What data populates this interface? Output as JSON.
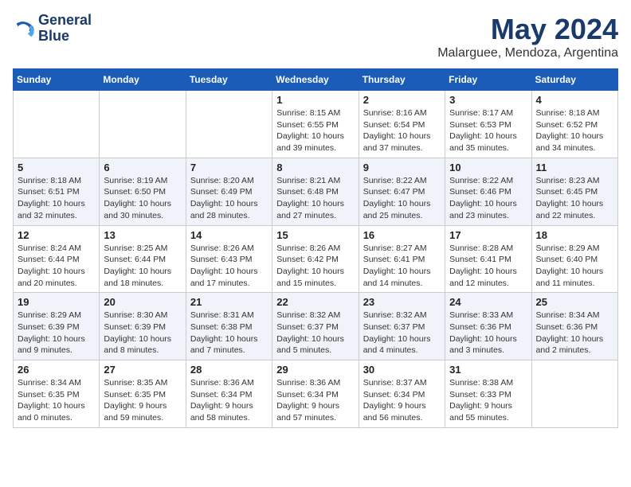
{
  "header": {
    "logo_line1": "General",
    "logo_line2": "Blue",
    "title": "May 2024",
    "subtitle": "Malarguee, Mendoza, Argentina"
  },
  "days_of_week": [
    "Sunday",
    "Monday",
    "Tuesday",
    "Wednesday",
    "Thursday",
    "Friday",
    "Saturday"
  ],
  "weeks": [
    [
      {
        "day": "",
        "info": ""
      },
      {
        "day": "",
        "info": ""
      },
      {
        "day": "",
        "info": ""
      },
      {
        "day": "1",
        "info": "Sunrise: 8:15 AM\nSunset: 6:55 PM\nDaylight: 10 hours\nand 39 minutes."
      },
      {
        "day": "2",
        "info": "Sunrise: 8:16 AM\nSunset: 6:54 PM\nDaylight: 10 hours\nand 37 minutes."
      },
      {
        "day": "3",
        "info": "Sunrise: 8:17 AM\nSunset: 6:53 PM\nDaylight: 10 hours\nand 35 minutes."
      },
      {
        "day": "4",
        "info": "Sunrise: 8:18 AM\nSunset: 6:52 PM\nDaylight: 10 hours\nand 34 minutes."
      }
    ],
    [
      {
        "day": "5",
        "info": "Sunrise: 8:18 AM\nSunset: 6:51 PM\nDaylight: 10 hours\nand 32 minutes."
      },
      {
        "day": "6",
        "info": "Sunrise: 8:19 AM\nSunset: 6:50 PM\nDaylight: 10 hours\nand 30 minutes."
      },
      {
        "day": "7",
        "info": "Sunrise: 8:20 AM\nSunset: 6:49 PM\nDaylight: 10 hours\nand 28 minutes."
      },
      {
        "day": "8",
        "info": "Sunrise: 8:21 AM\nSunset: 6:48 PM\nDaylight: 10 hours\nand 27 minutes."
      },
      {
        "day": "9",
        "info": "Sunrise: 8:22 AM\nSunset: 6:47 PM\nDaylight: 10 hours\nand 25 minutes."
      },
      {
        "day": "10",
        "info": "Sunrise: 8:22 AM\nSunset: 6:46 PM\nDaylight: 10 hours\nand 23 minutes."
      },
      {
        "day": "11",
        "info": "Sunrise: 8:23 AM\nSunset: 6:45 PM\nDaylight: 10 hours\nand 22 minutes."
      }
    ],
    [
      {
        "day": "12",
        "info": "Sunrise: 8:24 AM\nSunset: 6:44 PM\nDaylight: 10 hours\nand 20 minutes."
      },
      {
        "day": "13",
        "info": "Sunrise: 8:25 AM\nSunset: 6:44 PM\nDaylight: 10 hours\nand 18 minutes."
      },
      {
        "day": "14",
        "info": "Sunrise: 8:26 AM\nSunset: 6:43 PM\nDaylight: 10 hours\nand 17 minutes."
      },
      {
        "day": "15",
        "info": "Sunrise: 8:26 AM\nSunset: 6:42 PM\nDaylight: 10 hours\nand 15 minutes."
      },
      {
        "day": "16",
        "info": "Sunrise: 8:27 AM\nSunset: 6:41 PM\nDaylight: 10 hours\nand 14 minutes."
      },
      {
        "day": "17",
        "info": "Sunrise: 8:28 AM\nSunset: 6:41 PM\nDaylight: 10 hours\nand 12 minutes."
      },
      {
        "day": "18",
        "info": "Sunrise: 8:29 AM\nSunset: 6:40 PM\nDaylight: 10 hours\nand 11 minutes."
      }
    ],
    [
      {
        "day": "19",
        "info": "Sunrise: 8:29 AM\nSunset: 6:39 PM\nDaylight: 10 hours\nand 9 minutes."
      },
      {
        "day": "20",
        "info": "Sunrise: 8:30 AM\nSunset: 6:39 PM\nDaylight: 10 hours\nand 8 minutes."
      },
      {
        "day": "21",
        "info": "Sunrise: 8:31 AM\nSunset: 6:38 PM\nDaylight: 10 hours\nand 7 minutes."
      },
      {
        "day": "22",
        "info": "Sunrise: 8:32 AM\nSunset: 6:37 PM\nDaylight: 10 hours\nand 5 minutes."
      },
      {
        "day": "23",
        "info": "Sunrise: 8:32 AM\nSunset: 6:37 PM\nDaylight: 10 hours\nand 4 minutes."
      },
      {
        "day": "24",
        "info": "Sunrise: 8:33 AM\nSunset: 6:36 PM\nDaylight: 10 hours\nand 3 minutes."
      },
      {
        "day": "25",
        "info": "Sunrise: 8:34 AM\nSunset: 6:36 PM\nDaylight: 10 hours\nand 2 minutes."
      }
    ],
    [
      {
        "day": "26",
        "info": "Sunrise: 8:34 AM\nSunset: 6:35 PM\nDaylight: 10 hours\nand 0 minutes."
      },
      {
        "day": "27",
        "info": "Sunrise: 8:35 AM\nSunset: 6:35 PM\nDaylight: 9 hours\nand 59 minutes."
      },
      {
        "day": "28",
        "info": "Sunrise: 8:36 AM\nSunset: 6:34 PM\nDaylight: 9 hours\nand 58 minutes."
      },
      {
        "day": "29",
        "info": "Sunrise: 8:36 AM\nSunset: 6:34 PM\nDaylight: 9 hours\nand 57 minutes."
      },
      {
        "day": "30",
        "info": "Sunrise: 8:37 AM\nSunset: 6:34 PM\nDaylight: 9 hours\nand 56 minutes."
      },
      {
        "day": "31",
        "info": "Sunrise: 8:38 AM\nSunset: 6:33 PM\nDaylight: 9 hours\nand 55 minutes."
      },
      {
        "day": "",
        "info": ""
      }
    ]
  ]
}
